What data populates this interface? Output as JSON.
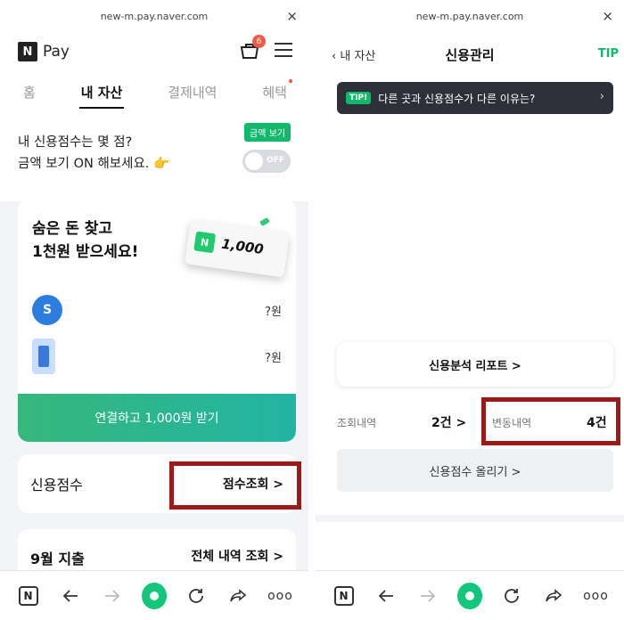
{
  "left": {
    "url": "new-m.pay.naver.com",
    "close": "×",
    "logo_letter": "N",
    "pay_label": "Pay",
    "cart_badge": "6",
    "tabs": [
      {
        "label": "홈"
      },
      {
        "label": "내 자산"
      },
      {
        "label": "결제내역"
      },
      {
        "label": "혜택"
      }
    ],
    "prompt": {
      "line1": "내 신용점수는 몇 점?",
      "line2": "금액 보기 ON 해보세요. 👉",
      "tooltip": "금액 보기",
      "toggle_label": "OFF"
    },
    "promo": {
      "line1": "숨은 돈 찾고",
      "line2": "1천원 받으세요!",
      "money_logo": "N",
      "money_amount": "1,000",
      "rows": [
        {
          "icon": "S",
          "value": "?원"
        },
        {
          "value": "?원"
        }
      ],
      "cta": "연결하고 1,000원 받기"
    },
    "credit": {
      "title": "신용점수",
      "link": "점수조회 >"
    },
    "spend": {
      "title": "9월 지출",
      "link": "전체 내역 조회 >"
    }
  },
  "right": {
    "url": "new-m.pay.naver.com",
    "close": "×",
    "back_label": "내 자산",
    "title": "신용관리",
    "tip": "TIP",
    "tip_badge": "TIP!",
    "tip_text": "다른 곳과 신용점수가 다른 이유는?",
    "report": "신용분석 리포트 >",
    "inquiry_label": "조회내역",
    "inquiry_value": "2건 >",
    "change_label": "변동내역",
    "change_value": "4건",
    "raise": "신용점수 올리기 >"
  },
  "bottom_bar": {
    "icons": [
      "naver-n-icon",
      "back-arrow-icon",
      "forward-arrow-icon",
      "home-circle-icon",
      "refresh-icon",
      "share-icon",
      "more-icon"
    ],
    "logo_letter": "N",
    "more": "ooo"
  },
  "colors": {
    "accent": "#12b86c",
    "highlight_box": "#9b1b1b"
  }
}
